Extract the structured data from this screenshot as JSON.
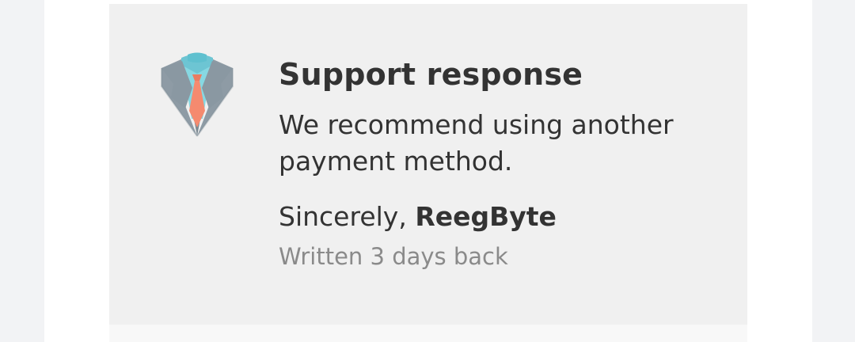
{
  "response": {
    "avatar_icon": "suit-tie-icon",
    "title": "Support response",
    "message": "We recommend using another payment method.",
    "signoff_prefix": "Sincerely,",
    "author": "ReegByte",
    "timestamp": "Written 3 days back"
  },
  "colors": {
    "panel_background": "#f0f0f0",
    "text_primary": "#333333",
    "text_secondary": "#8a8a8a",
    "suit": "#8e9ba5",
    "shirt": "#87d8e2",
    "tie": "#f58a6f"
  }
}
